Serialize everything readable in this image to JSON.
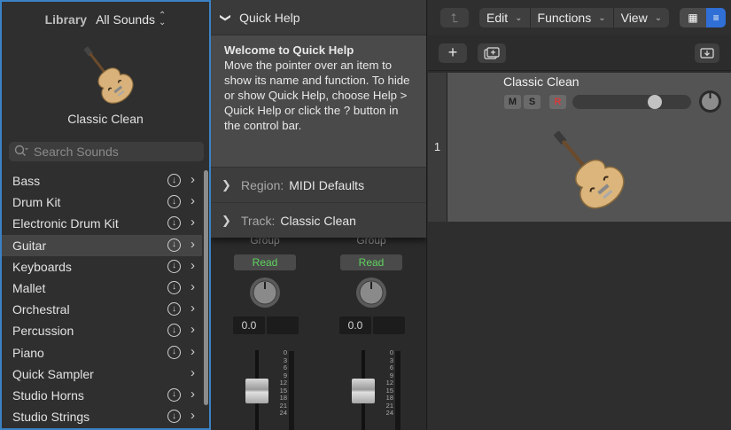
{
  "library": {
    "title": "Library",
    "sound_selector": "All Sounds",
    "patch_name": "Classic Clean",
    "search_placeholder": "Search Sounds",
    "categories": [
      {
        "label": "Bass",
        "download": true,
        "selected": false
      },
      {
        "label": "Drum Kit",
        "download": true,
        "selected": false
      },
      {
        "label": "Electronic Drum Kit",
        "download": true,
        "selected": false
      },
      {
        "label": "Guitar",
        "download": true,
        "selected": true
      },
      {
        "label": "Keyboards",
        "download": true,
        "selected": false
      },
      {
        "label": "Mallet",
        "download": true,
        "selected": false
      },
      {
        "label": "Orchestral",
        "download": true,
        "selected": false
      },
      {
        "label": "Percussion",
        "download": true,
        "selected": false
      },
      {
        "label": "Piano",
        "download": true,
        "selected": false
      },
      {
        "label": "Quick Sampler",
        "download": false,
        "selected": false
      },
      {
        "label": "Studio Horns",
        "download": true,
        "selected": false
      },
      {
        "label": "Studio Strings",
        "download": true,
        "selected": false
      }
    ]
  },
  "quick_help": {
    "header": "Quick Help",
    "title": "Welcome to Quick Help",
    "body": "Move the pointer over an item to show its name and function. To hide or show Quick Help, choose Help > Quick Help or click the ? button in the control bar.",
    "region_key": "Region:",
    "region_value": "MIDI Defaults",
    "track_key": "Track:",
    "track_value": "Classic Clean"
  },
  "mixer": {
    "strips": [
      {
        "group": "Group",
        "automation": "Read",
        "volume": "0.0"
      },
      {
        "group": "Group",
        "automation": "Read",
        "volume": "0.0"
      }
    ],
    "meter_scale": [
      "0",
      "3",
      "6",
      "9",
      "12",
      "15",
      "18",
      "21",
      "24"
    ]
  },
  "toolbar": {
    "edit": "Edit",
    "functions": "Functions",
    "view": "View"
  },
  "track": {
    "number": "1",
    "name": "Classic Clean",
    "mute_label": "M",
    "solo_label": "S",
    "record_label": "R",
    "volume_fraction": 0.72
  },
  "colors": {
    "accent": "#3b82c4",
    "read_green": "#5fd35f",
    "record_red": "#d43a3a",
    "view_toggle_blue": "#2f6fd6"
  },
  "icons": {
    "search": "search-icon",
    "download": "download-circle-icon",
    "chevron": "chevron-right-icon",
    "guitar": "hollow-body-guitar-icon"
  }
}
